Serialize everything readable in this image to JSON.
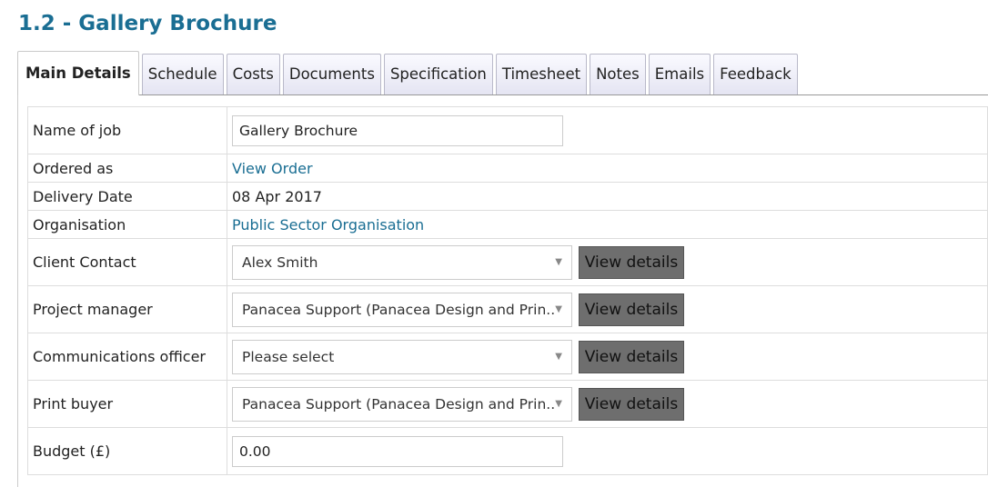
{
  "page": {
    "title": "1.2 - Gallery Brochure"
  },
  "tabs": [
    {
      "label": "Main Details"
    },
    {
      "label": "Schedule"
    },
    {
      "label": "Costs"
    },
    {
      "label": "Documents"
    },
    {
      "label": "Specification"
    },
    {
      "label": "Timesheet"
    },
    {
      "label": "Notes"
    },
    {
      "label": "Emails"
    },
    {
      "label": "Feedback"
    }
  ],
  "form": {
    "name_of_job": {
      "label": "Name of job",
      "value": "Gallery Brochure"
    },
    "ordered_as": {
      "label": "Ordered as",
      "link": "View Order"
    },
    "delivery_date": {
      "label": "Delivery Date",
      "value": "08 Apr 2017"
    },
    "organisation": {
      "label": "Organisation",
      "link": "Public Sector Organisation"
    },
    "client_contact": {
      "label": "Client Contact",
      "value": "Alex Smith"
    },
    "project_manager": {
      "label": "Project manager",
      "value": "Panacea Support (Panacea Design and Prin..."
    },
    "communications_officer": {
      "label": "Communications officer",
      "value": "Please select"
    },
    "print_buyer": {
      "label": "Print buyer",
      "value": "Panacea Support (Panacea Design and Prin..."
    },
    "budget": {
      "label": "Budget (£)",
      "value": "0.00"
    },
    "view_details_label": "View details"
  }
}
